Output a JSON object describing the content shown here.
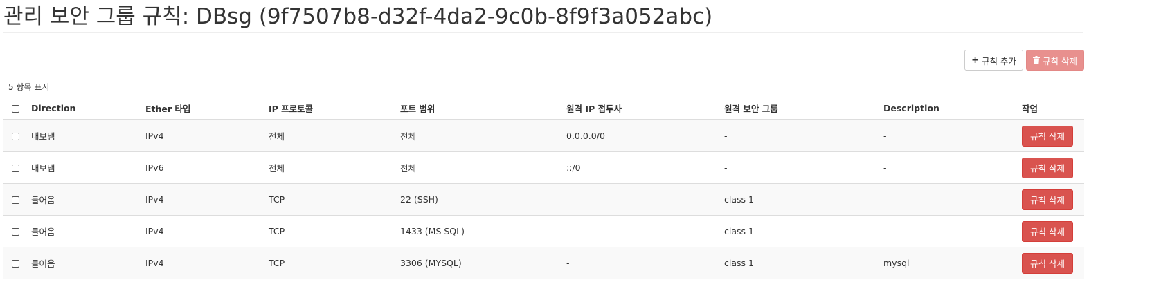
{
  "page": {
    "title": "관리 보안 그룹 규칙: DBsg (9f7507b8-d32f-4da2-9c0b-8f9f3a052abc)"
  },
  "toolbar": {
    "add_rule_label": "규칙 추가",
    "delete_rules_label": "규칙 삭제"
  },
  "table": {
    "count_text": "5 항목 표시",
    "headers": {
      "direction": "Direction",
      "ether_type": "Ether 타입",
      "ip_protocol": "IP 프로토콜",
      "port_range": "포트 범위",
      "remote_ip_prefix": "원격 IP 접두사",
      "remote_security_group": "원격 보안 그룹",
      "description": "Description",
      "actions": "작업"
    },
    "rows": [
      {
        "direction": "내보냄",
        "ether_type": "IPv4",
        "ip_protocol": "전체",
        "port_range": "전체",
        "remote_ip_prefix": "0.0.0.0/0",
        "remote_security_group": "-",
        "description": "-",
        "action_label": "규칙 삭제"
      },
      {
        "direction": "내보냄",
        "ether_type": "IPv6",
        "ip_protocol": "전체",
        "port_range": "전체",
        "remote_ip_prefix": "::/0",
        "remote_security_group": "-",
        "description": "-",
        "action_label": "규칙 삭제"
      },
      {
        "direction": "들어옴",
        "ether_type": "IPv4",
        "ip_protocol": "TCP",
        "port_range": "22 (SSH)",
        "remote_ip_prefix": "-",
        "remote_security_group": "class 1",
        "description": "-",
        "action_label": "규칙 삭제"
      },
      {
        "direction": "들어옴",
        "ether_type": "IPv4",
        "ip_protocol": "TCP",
        "port_range": "1433 (MS SQL)",
        "remote_ip_prefix": "-",
        "remote_security_group": "class 1",
        "description": "-",
        "action_label": "규칙 삭제"
      },
      {
        "direction": "들어옴",
        "ether_type": "IPv4",
        "ip_protocol": "TCP",
        "port_range": "3306 (MYSQL)",
        "remote_ip_prefix": "-",
        "remote_security_group": "class 1",
        "description": "mysql",
        "action_label": "규칙 삭제"
      }
    ]
  },
  "colors": {
    "danger": "#d9534f",
    "danger_disabled": "#e8908e",
    "row_stripe": "#f9f9f9",
    "border": "#dddddd"
  },
  "icons": {
    "add": "plus-icon",
    "delete": "trash-icon"
  }
}
